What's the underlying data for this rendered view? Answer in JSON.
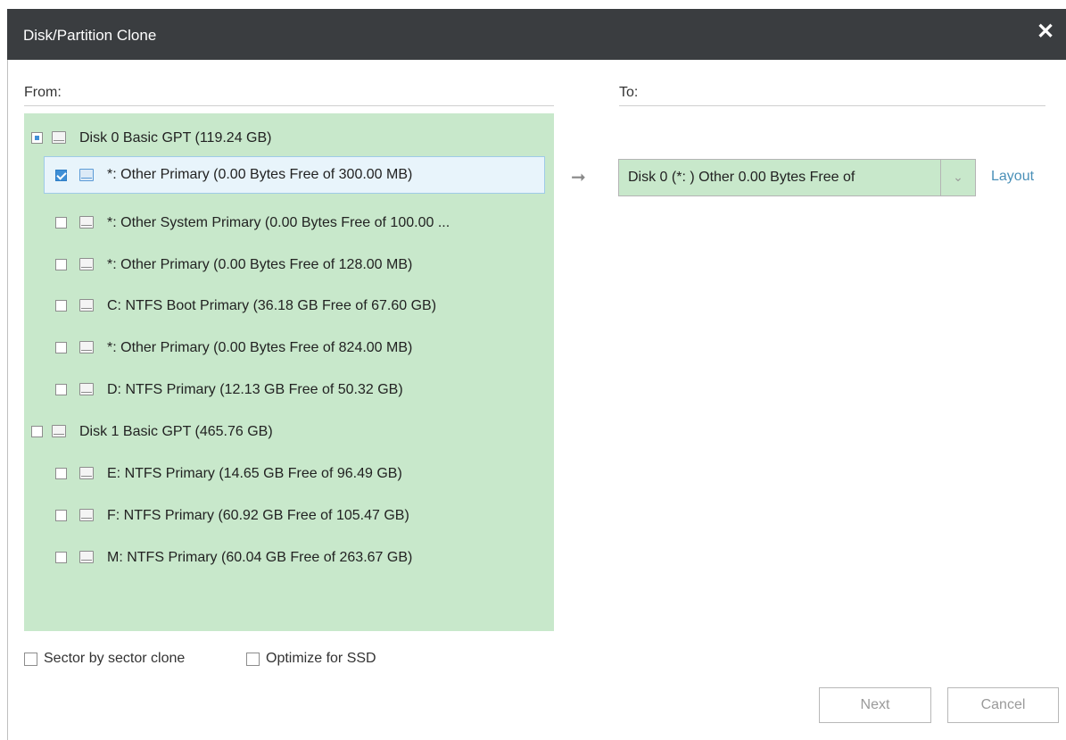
{
  "window": {
    "title": "Disk/Partition Clone",
    "close_glyph": "✕"
  },
  "from_label": "From:",
  "to_label": "To:",
  "tree": {
    "disks": [
      {
        "label": "Disk 0 Basic GPT (119.24 GB)",
        "check_state": "partial",
        "partitions": [
          {
            "label": "*: Other Primary  (0.00 Bytes Free of 300.00 MB)",
            "checked": true,
            "selected": true
          },
          {
            "label": "*: Other System Primary  (0.00 Bytes Free of 100.00 ...",
            "checked": false
          },
          {
            "label": "*: Other Primary  (0.00 Bytes Free of 128.00 MB)",
            "checked": false
          },
          {
            "label": "C: NTFS Boot Primary  (36.18 GB Free of 67.60 GB)",
            "checked": false
          },
          {
            "label": "*: Other Primary  (0.00 Bytes Free of 824.00 MB)",
            "checked": false
          },
          {
            "label": "D: NTFS Primary  (12.13 GB Free of 50.32 GB)",
            "checked": false
          }
        ]
      },
      {
        "label": "Disk 1 Basic GPT (465.76 GB)",
        "check_state": "unchecked",
        "partitions": [
          {
            "label": "E: NTFS Primary  (14.65 GB Free of 96.49 GB)",
            "checked": false
          },
          {
            "label": "F: NTFS Primary  (60.92 GB Free of 105.47 GB)",
            "checked": false
          },
          {
            "label": "M: NTFS Primary  (60.04 GB Free of 263.67 GB)",
            "checked": false
          }
        ]
      }
    ]
  },
  "target": {
    "value": "Disk 0 (*: ) Other 0.00 Bytes Free of",
    "dropdown_icon": "chevron-down-icon",
    "arrow_icon": "right-arrow-icon"
  },
  "layout_link": "Layout",
  "options": {
    "sector_by_sector": "Sector by sector clone",
    "optimize_ssd": "Optimize for SSD"
  },
  "buttons": {
    "next": "Next",
    "cancel": "Cancel"
  },
  "colors": {
    "titlebar": "#3a3d40",
    "tree_bg": "#c8e8cb",
    "selection": "#e8f4fb",
    "link": "#4a90b8",
    "checkbox_checked": "#3f8fd6"
  }
}
